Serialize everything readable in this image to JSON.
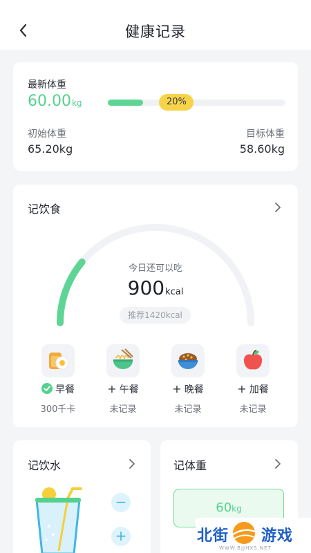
{
  "header": {
    "title": "健康记录"
  },
  "weight": {
    "latest_label": "最新体重",
    "latest_value": "60.00",
    "latest_unit": "kg",
    "progress_label": "20%",
    "progress_fraction": 0.2,
    "initial_label": "初始体重",
    "initial_value": "65.20kg",
    "target_label": "目标体重",
    "target_value": "58.60kg"
  },
  "diet": {
    "title": "记饮食",
    "hint": "今日还可以吃",
    "remaining_value": "900",
    "remaining_unit": "kcal",
    "recommend": "推荐1420kcal",
    "consumed_fraction": 0.22,
    "meals": [
      {
        "name": "早餐",
        "prefix": "check",
        "sub": "300千卡",
        "icon": "toast-egg-icon"
      },
      {
        "name": "午餐",
        "prefix": "+",
        "sub": "未记录",
        "icon": "noodle-bowl-icon"
      },
      {
        "name": "晚餐",
        "prefix": "+",
        "sub": "未记录",
        "icon": "rice-bowl-icon"
      },
      {
        "name": "加餐",
        "prefix": "+",
        "sub": "未记录",
        "icon": "apple-icon"
      }
    ]
  },
  "water": {
    "title": "记饮水",
    "minus": "−",
    "plus": "+"
  },
  "scale": {
    "title": "记体重",
    "value": "60",
    "unit": "kg"
  },
  "watermark": {
    "text_left": "北街",
    "text_right": "游戏",
    "url": "WWW.BJJHXS.NET"
  },
  "colors": {
    "green": "#55d18f",
    "yellow": "#f7d34a",
    "blue": "#41b6e6"
  }
}
